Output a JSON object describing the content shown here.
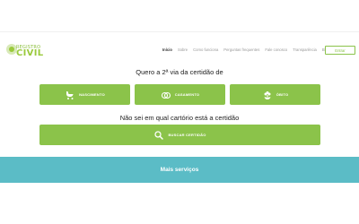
{
  "brand": {
    "line1": "REGISTRO",
    "line2": "CIVIL"
  },
  "nav": {
    "items": [
      "Início",
      "Sobre",
      "Como funciona",
      "Perguntas frequentes",
      "Fale conosco",
      "Transparência",
      "Blog"
    ],
    "active_index": 0,
    "enter_label": "Entrar"
  },
  "main": {
    "heading": "Quero a 2ª via da certidão de",
    "options": [
      {
        "label": "NASCIMENTO",
        "icon": "baby-stroller-icon"
      },
      {
        "label": "CASAMENTO",
        "icon": "wedding-rings-icon"
      },
      {
        "label": "ÓBITO",
        "icon": "flower-icon"
      }
    ],
    "subheading": "Não sei em qual cartório está a certidão",
    "search_label": "BUSCAR CERTIDÃO",
    "search_icon": "search-icon"
  },
  "more": {
    "label": "Mais serviços"
  },
  "colors": {
    "accent": "#8bc34a",
    "band": "#5bbcc6"
  }
}
